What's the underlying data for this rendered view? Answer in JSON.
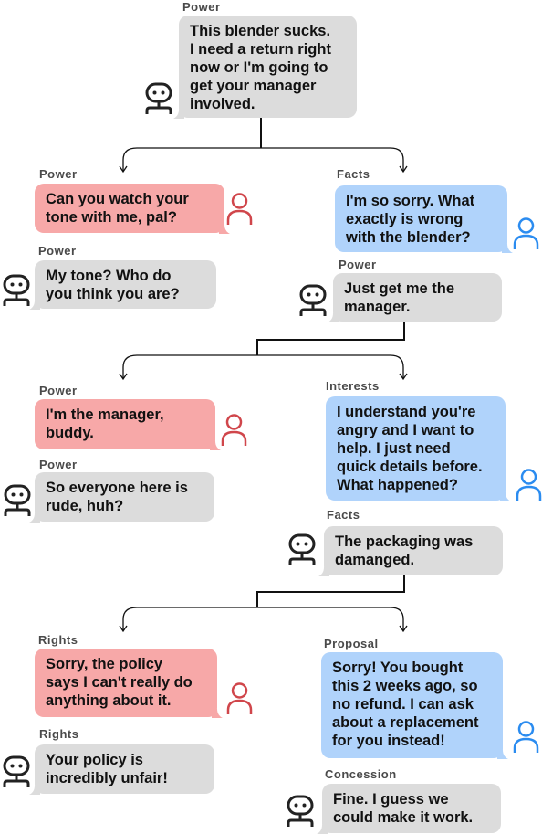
{
  "colors": {
    "customer_bubble": "#dcdcdc",
    "agent_bad_bubble": "#f7a8a8",
    "agent_good_bubble": "#b0d3fb",
    "agent_bad_icon": "#d0464b",
    "agent_good_icon": "#2b8cf0",
    "customer_icon": "#222222",
    "connector": "#111111"
  },
  "root": {
    "strategy": "Power",
    "speaker": "customer",
    "speaker_icon": "robot-icon",
    "text": "This blender sucks.\nI need a return right\nnow or I'm going to\nget your manager\ninvolved."
  },
  "turns": [
    {
      "left": {
        "agent": {
          "strategy": "Power",
          "speaker_icon": "person-icon",
          "tone": "red",
          "text": "Can you watch your\ntone with me, pal?"
        },
        "customer": {
          "strategy": "Power",
          "speaker_icon": "robot-icon",
          "text": "My tone? Who do\nyou think you are?"
        }
      },
      "right": {
        "agent": {
          "strategy": "Facts",
          "speaker_icon": "person-icon",
          "tone": "blue",
          "text": "I'm so sorry. What\nexactly is wrong\nwith the blender?"
        },
        "customer": {
          "strategy": "Power",
          "speaker_icon": "robot-icon",
          "text": "Just get me the\nmanager."
        }
      }
    },
    {
      "left": {
        "agent": {
          "strategy": "Power",
          "speaker_icon": "person-icon",
          "tone": "red",
          "text": "I'm the manager,\nbuddy."
        },
        "customer": {
          "strategy": "Power",
          "speaker_icon": "robot-icon",
          "text": "So everyone here is\nrude, huh?"
        }
      },
      "right": {
        "agent": {
          "strategy": "Interests",
          "speaker_icon": "person-icon",
          "tone": "blue",
          "text": "I understand you're\nangry and I want to\nhelp. I just need\nquick details before.\nWhat happened?"
        },
        "customer": {
          "strategy": "Facts",
          "speaker_icon": "robot-icon",
          "text": "The packaging was\ndamanged."
        }
      }
    },
    {
      "left": {
        "agent": {
          "strategy": "Rights",
          "speaker_icon": "person-icon",
          "tone": "red",
          "text": "Sorry, the policy\nsays I can't really do\nanything about it."
        },
        "customer": {
          "strategy": "Rights",
          "speaker_icon": "robot-icon",
          "text": "Your policy is\nincredibly unfair!"
        }
      },
      "right": {
        "agent": {
          "strategy": "Proposal",
          "speaker_icon": "person-icon",
          "tone": "blue",
          "text": "Sorry! You bought\nthis 2 weeks ago, so\nno refund. I can ask\nabout a replacement\nfor you instead!"
        },
        "customer": {
          "strategy": "Concession",
          "speaker_icon": "robot-icon",
          "text": "Fine. I guess we\ncould make it work."
        }
      }
    }
  ]
}
